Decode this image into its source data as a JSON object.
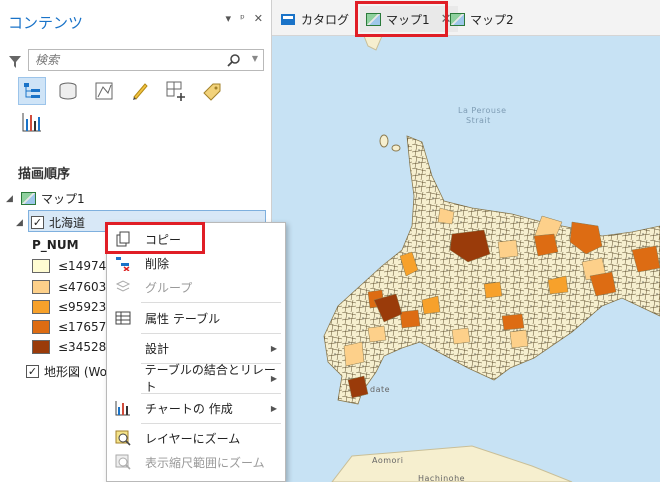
{
  "contents_pane": {
    "title": "コンテンツ",
    "controls": [
      "▾",
      "ᵖ",
      "✕"
    ],
    "search_placeholder": "検索",
    "section_title": "描画順序",
    "map_item": "マップ1",
    "layer_item": "北海道",
    "field_name": "P_NUM",
    "legend": [
      {
        "label": "≤14974",
        "color": "#fffcd2"
      },
      {
        "label": "≤47603",
        "color": "#fdd08a"
      },
      {
        "label": "≤95923",
        "color": "#f7a12b"
      },
      {
        "label": "≤176576",
        "color": "#dd6c13"
      },
      {
        "label": "≤345288",
        "color": "#9a3b0a"
      }
    ],
    "basemap_item": "地形図 (Wo"
  },
  "tabs": [
    {
      "label": "カタログ"
    },
    {
      "label": "マップ1",
      "close": "✕"
    },
    {
      "label": "マップ2"
    }
  ],
  "map": {
    "labels": {
      "la_perouse": "La Perouse",
      "strait": "Strait",
      "aomori": "Aomori",
      "hachinohe": "Hachinohe",
      "hakodate": "date"
    }
  },
  "context_menu": {
    "items": [
      {
        "label": "コピー",
        "icon": "copy-icon",
        "disabled": false
      },
      {
        "label": "削除",
        "icon": "remove-icon",
        "disabled": false
      },
      {
        "label": "グループ",
        "icon": "group-icon",
        "disabled": true
      },
      {
        "label": "属性 テーブル",
        "icon": "attribute-table-icon",
        "disabled": false
      },
      {
        "label": "設計",
        "icon": "",
        "disabled": false
      },
      {
        "label": "テーブルの結合とリレート",
        "icon": "",
        "disabled": false
      },
      {
        "label": "チャートの 作成",
        "icon": "chart-icon",
        "disabled": false
      },
      {
        "label": "レイヤーにズーム",
        "icon": "zoom-to-layer-icon",
        "disabled": false
      },
      {
        "label": "表示縮尺範囲にズーム",
        "icon": "zoom-to-scale-icon",
        "disabled": true
      }
    ]
  },
  "colors": {
    "accent": "#1a73c8",
    "highlight": "#e01e26",
    "sea": "#c7e2f4",
    "land": "#f6efcf"
  }
}
